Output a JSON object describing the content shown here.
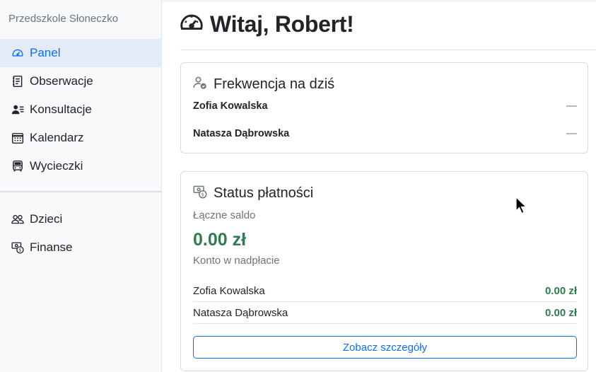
{
  "sidebar": {
    "brand": "Przedszkole Słoneczko",
    "items": [
      {
        "label": "Panel",
        "icon": "speedometer-icon",
        "active": true
      },
      {
        "label": "Obserwacje",
        "icon": "journal-icon"
      },
      {
        "label": "Konsultacje",
        "icon": "person-lines-icon"
      },
      {
        "label": "Kalendarz",
        "icon": "calendar-icon"
      },
      {
        "label": "Wycieczki",
        "icon": "bus-icon"
      }
    ],
    "items2": [
      {
        "label": "Dzieci",
        "icon": "people-icon"
      },
      {
        "label": "Finanse",
        "icon": "cash-coin-icon"
      }
    ]
  },
  "main": {
    "title": "Witaj, Robert!"
  },
  "attendance": {
    "title": "Frekwencja na dziś",
    "rows": [
      {
        "name": "Zofia Kowalska",
        "status": "—"
      },
      {
        "name": "Natasza Dąbrowska",
        "status": "—"
      }
    ]
  },
  "payments": {
    "title": "Status płatności",
    "balance_label": "Łączne saldo",
    "balance": "0.00 zł",
    "balance_note": "Konto w nadpłacie",
    "rows": [
      {
        "name": "Zofia Kowalska",
        "amount": "0.00 zł"
      },
      {
        "name": "Natasza Dąbrowska",
        "amount": "0.00 zł"
      }
    ],
    "details_button": "Zobacz szczegóły"
  },
  "colors": {
    "accent": "#0d6efd",
    "success": "#2e7d4f",
    "sidebar_bg": "#f8f9fa",
    "active_bg": "#e4ebf7"
  }
}
